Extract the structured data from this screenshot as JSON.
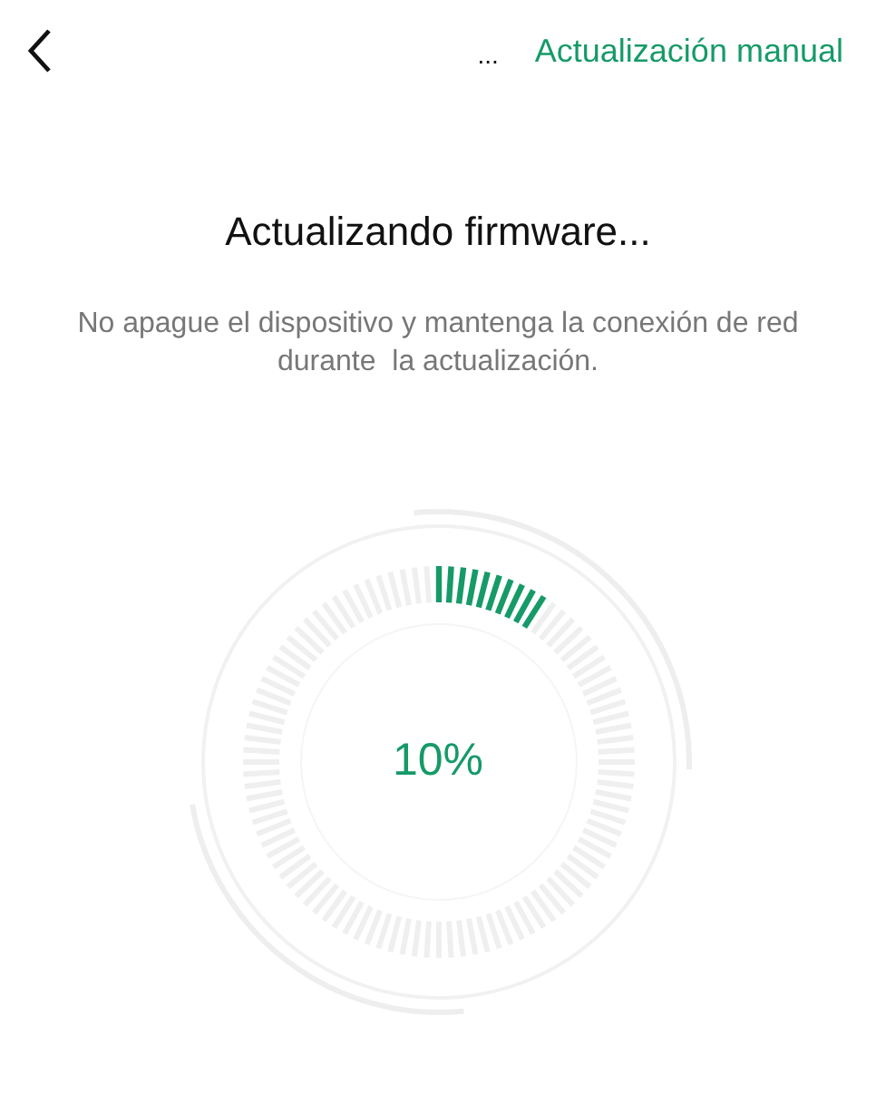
{
  "header": {
    "menu": "...",
    "action": "Actualización manual"
  },
  "title": "Actualizando firmware...",
  "message": "No apague el dispositivo y mantenga la conexión de red durante  la actualización.",
  "progress": {
    "reading": "10%"
  }
}
